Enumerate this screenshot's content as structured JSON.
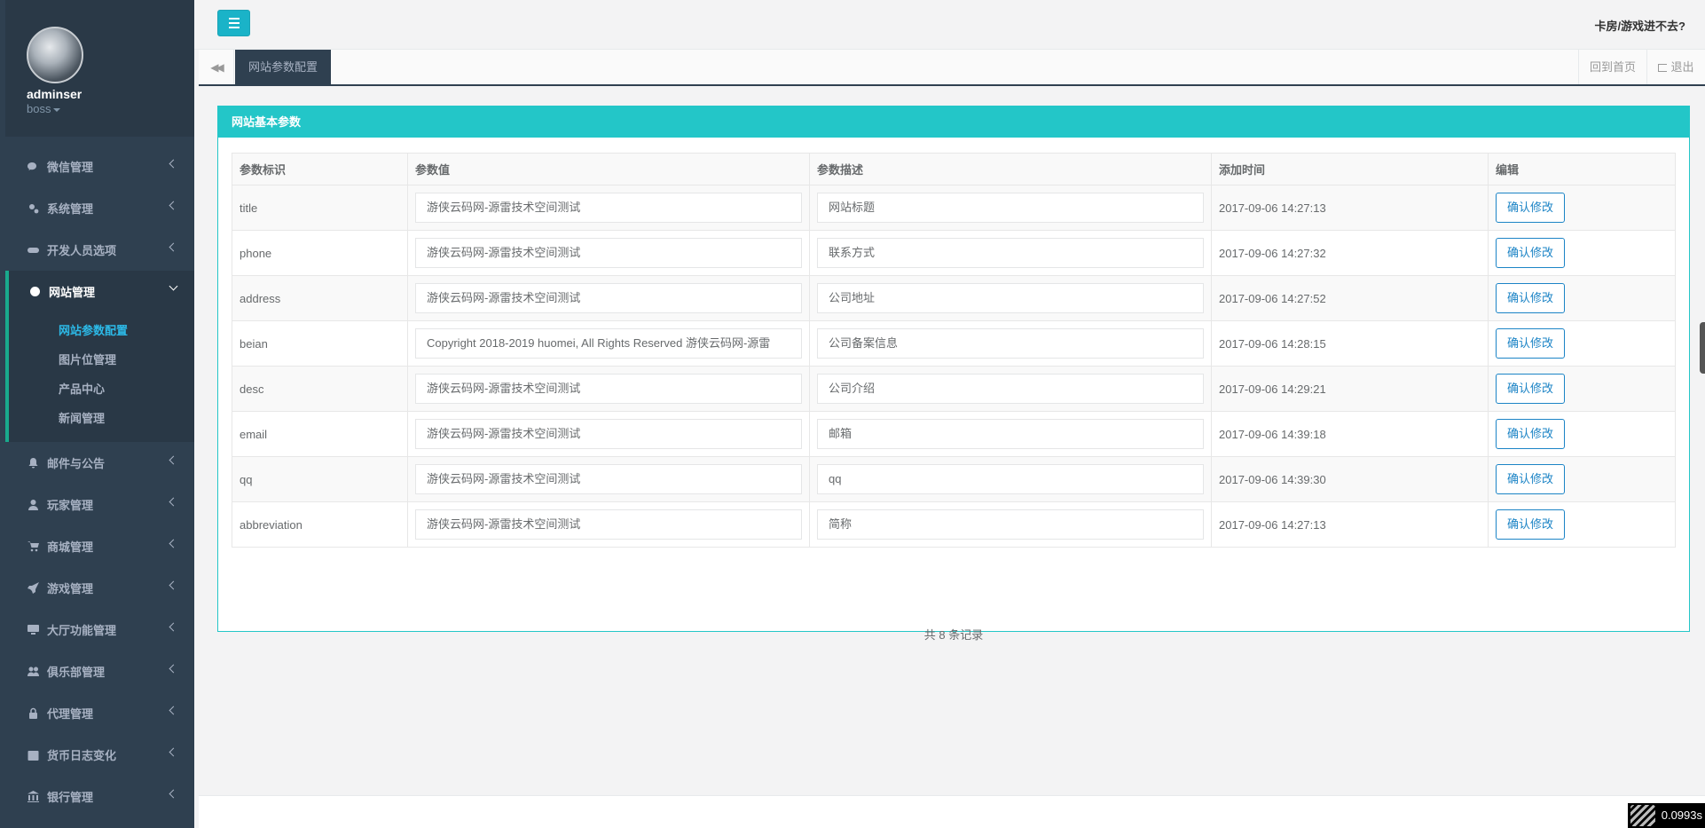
{
  "sidebar": {
    "user": {
      "name": "adminser",
      "role": "boss"
    },
    "menu": [
      {
        "label": "微信管理",
        "icon": "wechat-icon"
      },
      {
        "label": "系统管理",
        "icon": "cogs-icon"
      },
      {
        "label": "开发人员选项",
        "icon": "gamepad-icon"
      },
      {
        "label": "网站管理",
        "icon": "ie-icon",
        "expanded": true,
        "children": [
          "网站参数配置",
          "图片位管理",
          "产品中心",
          "新闻管理"
        ]
      },
      {
        "label": "邮件与公告",
        "icon": "bell-icon"
      },
      {
        "label": "玩家管理",
        "icon": "user-icon"
      },
      {
        "label": "商城管理",
        "icon": "cart-icon"
      },
      {
        "label": "游戏管理",
        "icon": "rocket-icon"
      },
      {
        "label": "大厅功能管理",
        "icon": "desktop-icon"
      },
      {
        "label": "俱乐部管理",
        "icon": "users-icon"
      },
      {
        "label": "代理管理",
        "icon": "lock-icon"
      },
      {
        "label": "货币日志变化",
        "icon": "calendar-icon"
      },
      {
        "label": "银行管理",
        "icon": "bank-icon"
      }
    ]
  },
  "topbar": {
    "help_link": "卡房/游戏进不去?"
  },
  "tabs": {
    "active": "网站参数配置",
    "home": "回到首页",
    "logout": "退出"
  },
  "panel": {
    "title": "网站基本参数",
    "columns": [
      "参数标识",
      "参数值",
      "参数描述",
      "添加时间",
      "编辑"
    ],
    "rows": [
      {
        "key": "title",
        "value": "游侠云码网-源雷技术空间测试",
        "desc": "网站标题",
        "time": "2017-09-06 14:27:13"
      },
      {
        "key": "phone",
        "value": "游侠云码网-源雷技术空间测试",
        "desc": "联系方式",
        "time": "2017-09-06 14:27:32"
      },
      {
        "key": "address",
        "value": "游侠云码网-源雷技术空间测试",
        "desc": "公司地址",
        "time": "2017-09-06 14:27:52"
      },
      {
        "key": "beian",
        "value": "Copyright 2018-2019 huomei, All Rights Reserved 游侠云码网-源雷",
        "desc": "公司备案信息",
        "time": "2017-09-06 14:28:15"
      },
      {
        "key": "desc",
        "value": "游侠云码网-源雷技术空间测试",
        "desc": "公司介绍",
        "time": "2017-09-06 14:29:21"
      },
      {
        "key": "email",
        "value": "游侠云码网-源雷技术空间测试",
        "desc": "邮箱",
        "time": "2017-09-06 14:39:18"
      },
      {
        "key": "qq",
        "value": "游侠云码网-源雷技术空间测试",
        "desc": "qq",
        "time": "2017-09-06 14:39:30"
      },
      {
        "key": "abbreviation",
        "value": "游侠云码网-源雷技术空间测试",
        "desc": "简称",
        "time": "2017-09-06 14:27:13"
      }
    ],
    "button_label": "确认修改",
    "records": "共 8 条记录"
  },
  "debug": {
    "timer": "0.0993s"
  },
  "colors": {
    "sidebar": "#2f4050",
    "accent": "#23c6c8",
    "button": "#1c84c6",
    "active_link": "#2cb9e7"
  }
}
